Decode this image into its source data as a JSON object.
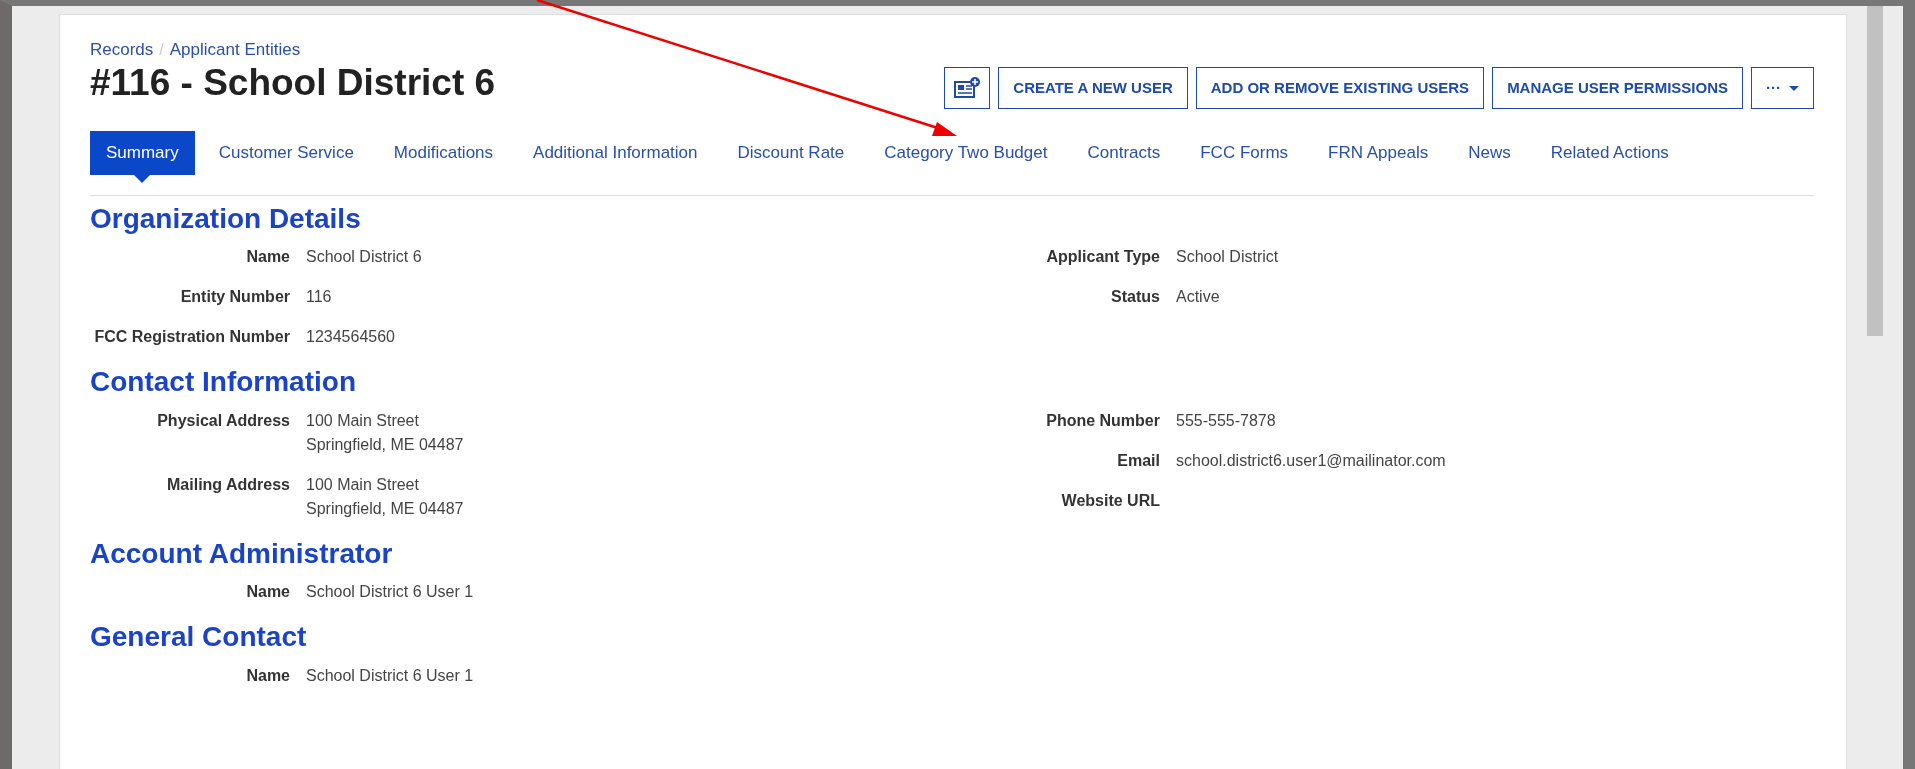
{
  "breadcrumb": [
    "Records",
    "Applicant Entities"
  ],
  "breadcrumb_separator": "/",
  "title": "#116 - School District 6",
  "toolbar": [
    {
      "kind": "icon"
    },
    {
      "kind": "text",
      "label": "CREATE A NEW USER"
    },
    {
      "kind": "text",
      "label": "ADD OR REMOVE EXISTING USERS"
    },
    {
      "kind": "text",
      "label": "MANAGE USER PERMISSIONS"
    },
    {
      "kind": "more",
      "label": "···"
    }
  ],
  "tabs": [
    {
      "label": "Summary",
      "selected": true
    },
    {
      "label": "Customer Service",
      "selected": false
    },
    {
      "label": "Modifications",
      "selected": false
    },
    {
      "label": "Additional Information",
      "selected": false
    },
    {
      "label": "Discount Rate",
      "selected": false
    },
    {
      "label": "Category Two Budget",
      "selected": false
    },
    {
      "label": "Contracts",
      "selected": false
    },
    {
      "label": "FCC Forms",
      "selected": false
    },
    {
      "label": "FRN Appeals",
      "selected": false
    },
    {
      "label": "News",
      "selected": false
    },
    {
      "label": "Related Actions",
      "selected": false
    }
  ],
  "sections": [
    {
      "heading": "Organization Details",
      "left": [
        {
          "label": "Name",
          "value": [
            "School District 6"
          ]
        },
        {
          "label": "Entity Number",
          "value": [
            "116"
          ]
        },
        {
          "label": "FCC Registration Number",
          "value": [
            "1234564560"
          ]
        }
      ],
      "right": [
        {
          "label": "Applicant Type",
          "value": [
            "School District"
          ]
        },
        {
          "label": "Status",
          "value": [
            "Active"
          ]
        }
      ]
    },
    {
      "heading": "Contact Information",
      "left": [
        {
          "label": "Physical Address",
          "value": [
            "100 Main Street",
            "Springfield, ME 04487"
          ]
        },
        {
          "label": "Mailing Address",
          "value": [
            "100 Main Street",
            "Springfield, ME 04487"
          ]
        }
      ],
      "right": [
        {
          "label": "Phone Number",
          "value": [
            "555-555-7878"
          ]
        },
        {
          "label": "Email",
          "value": [
            "school.district6.user1@mailinator.com"
          ]
        },
        {
          "label": "Website URL"
        }
      ]
    },
    {
      "heading": "Account Administrator",
      "left": [
        {
          "label": "Name",
          "value": [
            "School District 6 User 1"
          ]
        }
      ]
    },
    {
      "heading": "General Contact",
      "left": [
        {
          "label": "Name",
          "value": [
            "School District 6 User 1"
          ]
        }
      ]
    }
  ]
}
